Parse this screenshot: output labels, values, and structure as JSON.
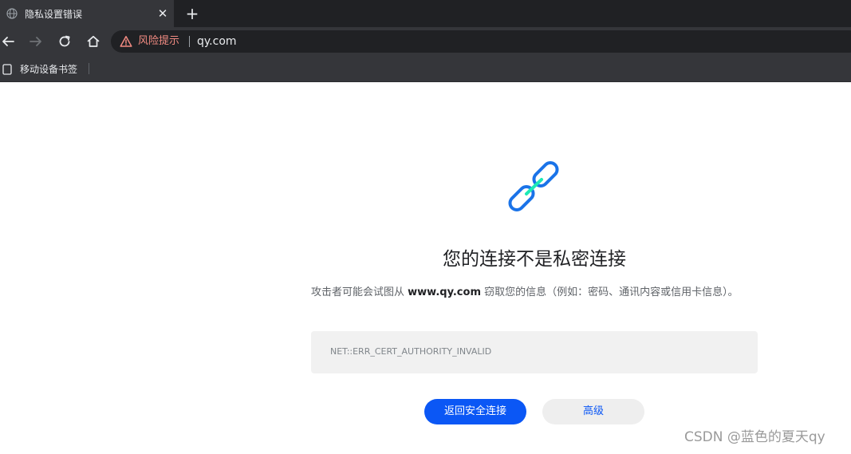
{
  "tab": {
    "title": "隐私设置错误",
    "icon": "globe-icon"
  },
  "toolbar": {
    "risk_label": "风险提示",
    "url": "qy.com"
  },
  "bookmarks": {
    "items": [
      {
        "label": "移动设备书签",
        "icon": "bookmark-folder-icon"
      }
    ]
  },
  "error_page": {
    "icon": "broken-link-icon",
    "heading": "您的连接不是私密连接",
    "desc_prefix": "攻击者可能会试图从 ",
    "desc_host": "www.qy.com",
    "desc_suffix": " 窃取您的信息（例如：密码、通讯内容或信用卡信息）。",
    "error_code": "NET::ERR_CERT_AUTHORITY_INVALID",
    "back_button": "返回安全连接",
    "advanced_button": "高级"
  },
  "watermark": "CSDN @蓝色的夏天qy",
  "colors": {
    "accent": "#0b57f5",
    "warning": "#f28b82",
    "toolbar_bg": "#35363a",
    "tabstrip_bg": "#202124",
    "icon_blue": "#1a73e8",
    "icon_teal": "#1de9b6"
  }
}
